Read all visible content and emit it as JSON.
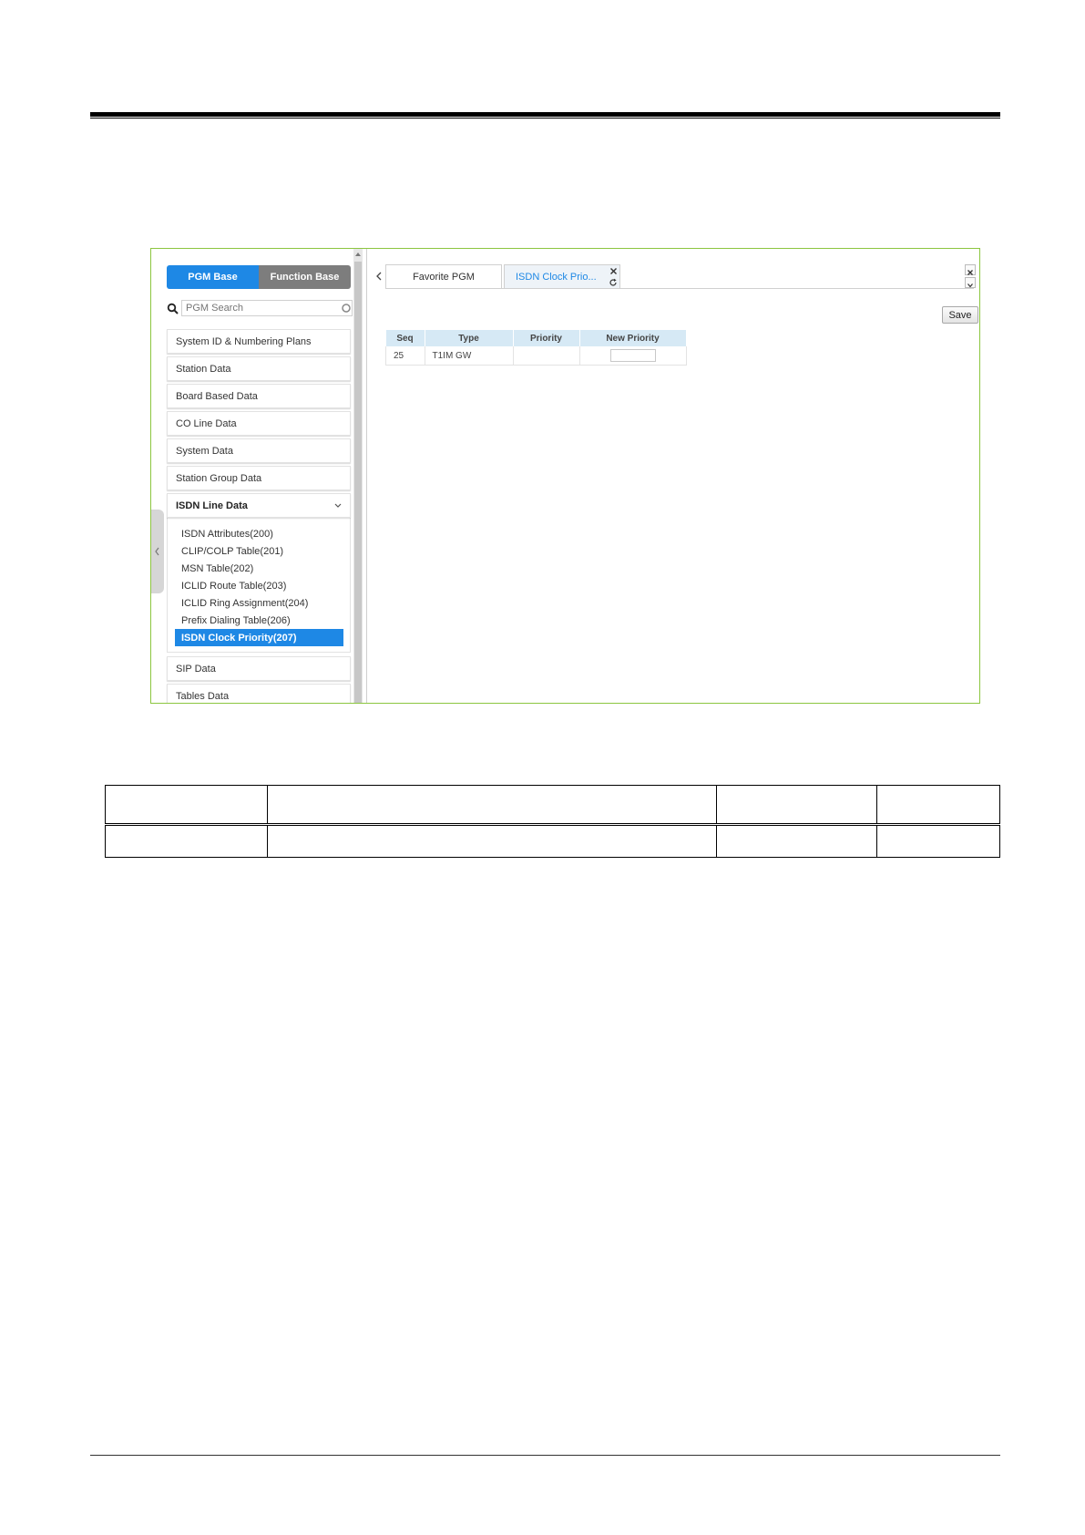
{
  "sidebar": {
    "segments": [
      "PGM Base",
      "Function Base"
    ],
    "search": {
      "placeholder": "PGM Search"
    },
    "menu_before": [
      "System ID & Numbering Plans",
      "Station Data",
      "Board Based Data",
      "CO Line Data",
      "System Data",
      "Station Group Data"
    ],
    "open_group": "ISDN Line Data",
    "submenu": [
      "ISDN Attributes(200)",
      "CLIP/COLP Table(201)",
      "MSN Table(202)",
      "ICLID Route Table(203)",
      "ICLID Ring Assignment(204)",
      "Prefix Dialing Table(206)",
      "ISDN Clock Priority(207)"
    ],
    "selected_submenu_index": 6,
    "menu_after": [
      "SIP Data",
      "Tables Data"
    ]
  },
  "tabs": {
    "favorite": "Favorite PGM",
    "current": "ISDN Clock Prio..."
  },
  "toolbar": {
    "save_label": "Save"
  },
  "grid": {
    "columns": [
      "Seq",
      "Type",
      "Priority",
      "New Priority"
    ],
    "rows": [
      {
        "seq": "25",
        "type": "T1IM GW",
        "priority": "",
        "new_priority": ""
      }
    ]
  },
  "colors": {
    "accent": "#1e88e5",
    "frame_border": "#8cc63f",
    "grid_header": "#d6e9f5",
    "segment_inactive": "#7d7d7d"
  },
  "icons": {
    "search": "search-icon",
    "clear": "clear-circle-icon",
    "chevron": "chevron-down-icon",
    "tab_prev": "chevron-left-icon",
    "tab_close": "close-icon",
    "tab_refresh": "refresh-icon",
    "collapse": "chevron-left-icon"
  }
}
